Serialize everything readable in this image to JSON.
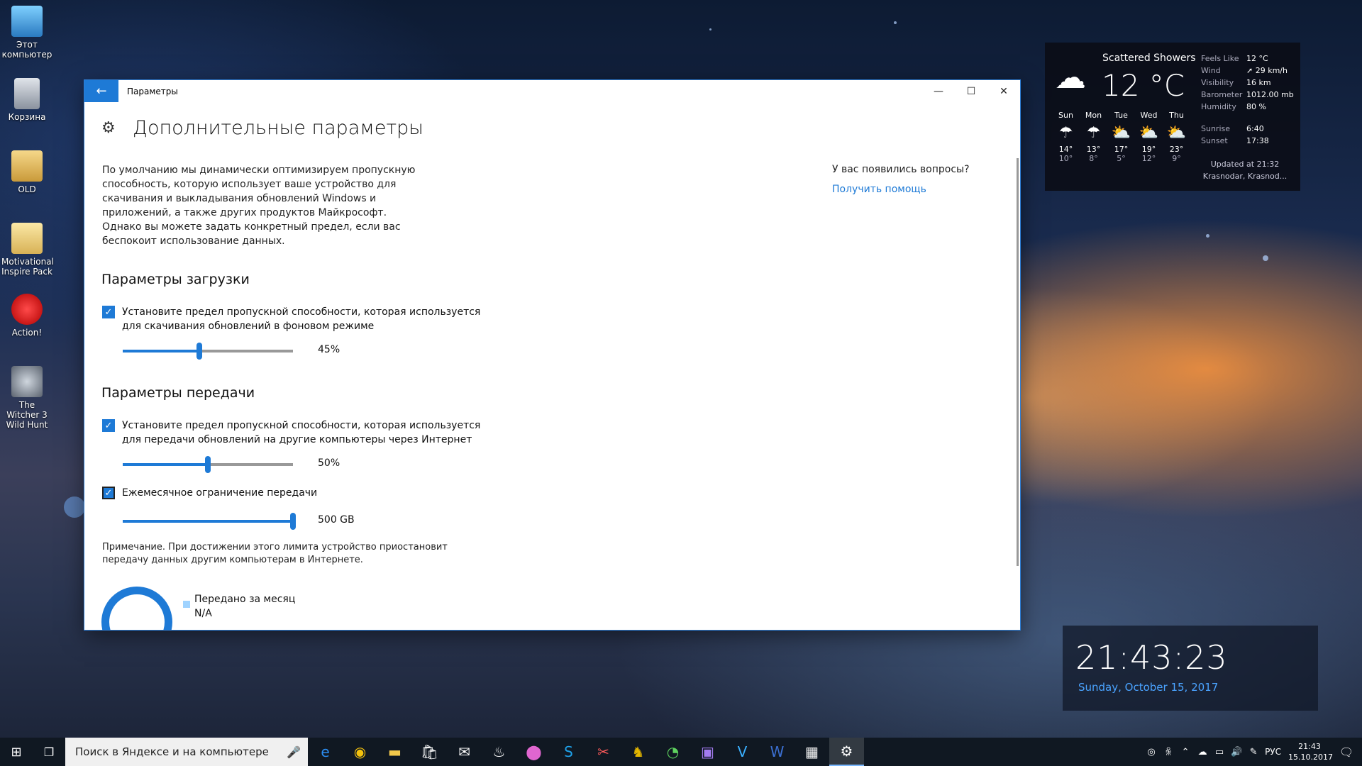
{
  "desktop": {
    "icons": [
      {
        "label": "Этот компьютер"
      },
      {
        "label": "Корзина"
      },
      {
        "label": "OLD"
      },
      {
        "label": "Motivational Inspire Pack"
      },
      {
        "label": "Action!"
      },
      {
        "label": "The Witcher 3 Wild Hunt"
      }
    ]
  },
  "window": {
    "title": "Параметры",
    "page_title": "Дополнительные параметры",
    "description": "По умолчанию мы динамически оптимизируем пропускную способность, которую использует ваше устройство для скачивания и выкладывания обновлений Windows и приложений, а также других продуктов Майкрософт. Однако вы можете задать конкретный предел, если вас беспокоит использование данных.",
    "download_section": {
      "heading": "Параметры загрузки",
      "limit_label": "Установите предел пропускной способности, которая используется для скачивания обновлений в фоновом режиме",
      "checked": true,
      "slider_fraction": 0.45,
      "slider_value": "45%"
    },
    "upload_section": {
      "heading": "Параметры передачи",
      "limit_label": "Установите предел пропускной способности, которая используется для передачи обновлений на другие компьютеры через Интернет",
      "checked": true,
      "slider_fraction": 0.5,
      "slider_value": "50%",
      "monthly_label": "Ежемесячное ограничение передачи",
      "monthly_checked": true,
      "monthly_fraction": 1.0,
      "monthly_value": "500 GB"
    },
    "note": "Примечание. При достижении этого лимита устройство приостановит передачу данных другим компьютерам в Интернете.",
    "usage": {
      "legend_label": "Передано за месяц",
      "legend_value": "N/A"
    },
    "help": {
      "question": "У вас появились вопросы?",
      "link": "Получить помощь"
    }
  },
  "weather": {
    "condition": "Scattered Showers",
    "temperature": "12 °C",
    "stats": [
      {
        "k": "Feels Like",
        "v": "12 °C"
      },
      {
        "k": "Wind",
        "v": "➚ 29 km/h"
      },
      {
        "k": "Visibility",
        "v": "16 km"
      },
      {
        "k": "Barometer",
        "v": "1012.00 mb"
      },
      {
        "k": "Humidity",
        "v": "80 %"
      }
    ],
    "sun": [
      {
        "k": "Sunrise",
        "v": "6:40"
      },
      {
        "k": "Sunset",
        "v": "17:38"
      }
    ],
    "forecast": [
      {
        "day": "Sun",
        "hi": "14°",
        "lo": "10°",
        "icon": "rain-icon"
      },
      {
        "day": "Mon",
        "hi": "13°",
        "lo": "8°",
        "icon": "rain-icon"
      },
      {
        "day": "Tue",
        "hi": "17°",
        "lo": "5°",
        "icon": "partly-cloudy-icon"
      },
      {
        "day": "Wed",
        "hi": "19°",
        "lo": "12°",
        "icon": "partly-cloudy-icon"
      },
      {
        "day": "Thu",
        "hi": "23°",
        "lo": "9°",
        "icon": "partly-cloudy-icon"
      }
    ],
    "updated": "Updated at 21:32",
    "location": "Krasnodar, Krasnod..."
  },
  "clock": {
    "time": "21:43:23",
    "date": "Sunday, October 15, 2017"
  },
  "taskbar": {
    "search_placeholder": "Поиск в Яндексе и на компьютере",
    "language": "РУС",
    "time": "21:43",
    "date": "15.10.2017"
  }
}
